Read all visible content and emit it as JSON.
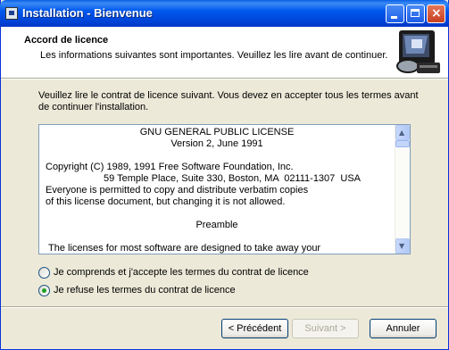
{
  "window": {
    "title": "Installation - Bienvenue"
  },
  "header": {
    "title": "Accord de licence",
    "subtitle": "Les informations suivantes sont importantes. Veuillez les lire avant de continuer."
  },
  "intro": "Veuillez lire le contrat de licence suivant. Vous devez en accepter tous les termes avant de continuer l'installation.",
  "license": {
    "lines": [
      "GNU GENERAL PUBLIC LICENSE",
      "Version 2, June 1991",
      "Copyright (C) 1989, 1991 Free Software Foundation, Inc.",
      "59 Temple Place, Suite 330, Boston, MA  02111-1307  USA",
      "Everyone is permitted to copy and distribute verbatim copies",
      "of this license document, but changing it is not allowed.",
      "Preamble",
      "The licenses for most software are designed to take away your"
    ]
  },
  "options": {
    "accept": {
      "label": "Je comprends et j'accepte les termes du contrat de licence",
      "selected": false
    },
    "refuse": {
      "label": "Je refuse les termes du contrat de licence",
      "selected": true
    }
  },
  "buttons": {
    "prev": "< Précédent",
    "next": "Suivant >",
    "cancel": "Annuler"
  },
  "icons": {
    "app": "installer-icon",
    "logo": "computer-setup-icon",
    "minimize": "minimize-icon",
    "maximize": "maximize-icon",
    "close": "close-icon",
    "scroll_up": "scroll-up-arrow-icon",
    "scroll_down": "scroll-down-arrow-icon"
  },
  "colors": {
    "titlebar": "#0058ee",
    "accent_radio": "#21a121",
    "disabled_text": "#aca899"
  }
}
